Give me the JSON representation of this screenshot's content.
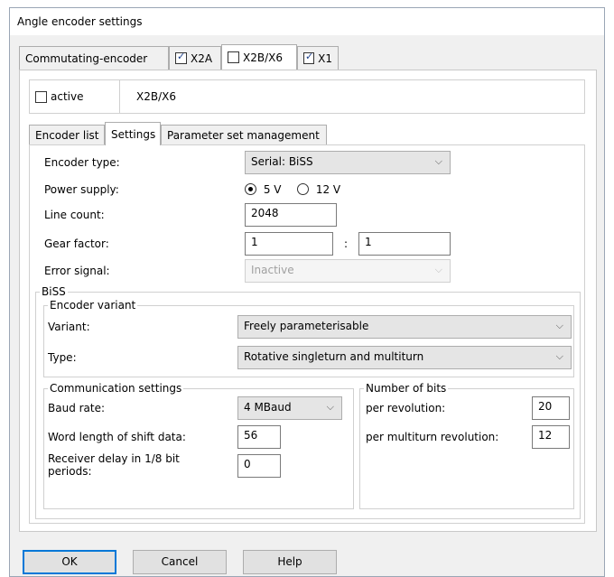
{
  "window": {
    "title": "Angle encoder settings"
  },
  "top_tabs": [
    {
      "label": "Commutating-encoder",
      "checkbox": null
    },
    {
      "label": "X2A",
      "checked": true
    },
    {
      "label": "X2B/X6",
      "checked": false
    },
    {
      "label": "X1",
      "checked": true
    }
  ],
  "header": {
    "active_label": "active",
    "active_checked": false,
    "name": "X2B/X6"
  },
  "sub_tabs": [
    "Encoder list",
    "Settings",
    "Parameter set management"
  ],
  "settings": {
    "encoder_type_label": "Encoder type:",
    "encoder_type_value": "Serial: BiSS",
    "power_supply_label": "Power supply:",
    "power_5v": "5 V",
    "power_12v": "12 V",
    "power_selected": "5 V",
    "line_count_label": "Line count:",
    "line_count_value": "2048",
    "gear_factor_label": "Gear factor:",
    "gear_num": "1",
    "gear_sep": ":",
    "gear_den": "1",
    "error_signal_label": "Error signal:",
    "error_signal_value": "Inactive"
  },
  "biss": {
    "group_label": "BiSS",
    "variant_group_label": "Encoder variant",
    "variant_label": "Variant:",
    "variant_value": "Freely parameterisable",
    "type_label": "Type:",
    "type_value": "Rotative singleturn and multiturn",
    "comm_group_label": "Communication settings",
    "baud_label": "Baud rate:",
    "baud_value": "4 MBaud",
    "word_len_label": "Word length of shift data:",
    "word_len_value": "56",
    "rx_delay_label": "Receiver delay in 1/8 bit periods:",
    "rx_delay_value": "0",
    "bits_group_label": "Number of bits",
    "per_rev_label": "per revolution:",
    "per_rev_value": "20",
    "per_multi_label": "per multiturn revolution:",
    "per_multi_value": "12"
  },
  "buttons": {
    "ok": "OK",
    "cancel": "Cancel",
    "help": "Help"
  }
}
